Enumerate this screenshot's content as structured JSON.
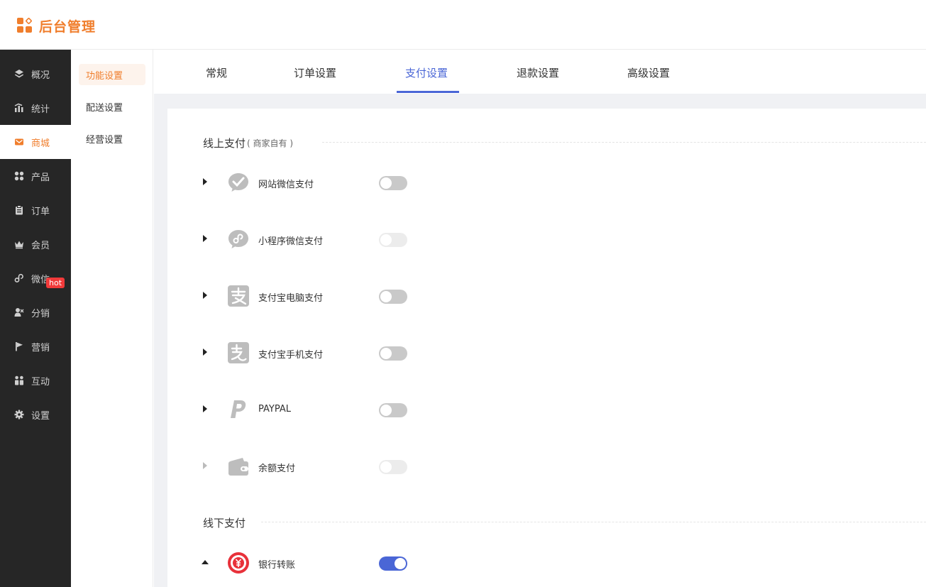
{
  "header": {
    "logo_text": "后台管理",
    "logo_color": "#f07e2c"
  },
  "sidebar": {
    "items": [
      {
        "label": "概况",
        "icon": "layers-icon"
      },
      {
        "label": "统计",
        "icon": "chart-icon"
      },
      {
        "label": "商城",
        "icon": "mail-icon",
        "active": true
      },
      {
        "label": "产品",
        "icon": "grid-icon"
      },
      {
        "label": "订单",
        "icon": "clipboard-icon"
      },
      {
        "label": "会员",
        "icon": "crown-icon"
      },
      {
        "label": "微信",
        "icon": "wechat-icon"
      },
      {
        "label": "分销",
        "icon": "users-icon"
      },
      {
        "label": "营销",
        "icon": "flag-icon",
        "badge": "hot"
      },
      {
        "label": "互动",
        "icon": "people-icon"
      },
      {
        "label": "设置",
        "icon": "gear-icon"
      }
    ]
  },
  "subnav": {
    "items": [
      {
        "label": "功能设置",
        "active": true
      },
      {
        "label": "配送设置"
      },
      {
        "label": "经营设置"
      }
    ]
  },
  "tabs": [
    {
      "label": "常规"
    },
    {
      "label": "订单设置"
    },
    {
      "label": "支付设置",
      "active": true
    },
    {
      "label": "退款设置"
    },
    {
      "label": "高级设置"
    }
  ],
  "online": {
    "title": "线上支付",
    "note": "( 商家自有 )",
    "methods": [
      {
        "label": "网站微信支付",
        "icon": "wechat-pay-icon",
        "state": "off"
      },
      {
        "label": "小程序微信支付",
        "icon": "miniprogram-icon",
        "state": "disabled"
      },
      {
        "label": "支付宝电脑支付",
        "icon": "alipay-icon",
        "state": "off"
      },
      {
        "label": "支付宝手机支付",
        "icon": "alipay-mobile-icon",
        "state": "off"
      },
      {
        "label": "PAYPAL",
        "icon": "paypal-icon",
        "state": "off"
      },
      {
        "label": "余额支付",
        "icon": "wallet-icon",
        "state": "disabled"
      }
    ]
  },
  "offline": {
    "title": "线下支付",
    "methods": [
      {
        "label": "银行转账",
        "icon": "bank-transfer-icon",
        "state": "on"
      }
    ]
  },
  "colors": {
    "accent": "#f07e2c",
    "primary": "#4a66d6",
    "sidebar_bg": "#262626",
    "hot_badge": "#f23a3a"
  }
}
